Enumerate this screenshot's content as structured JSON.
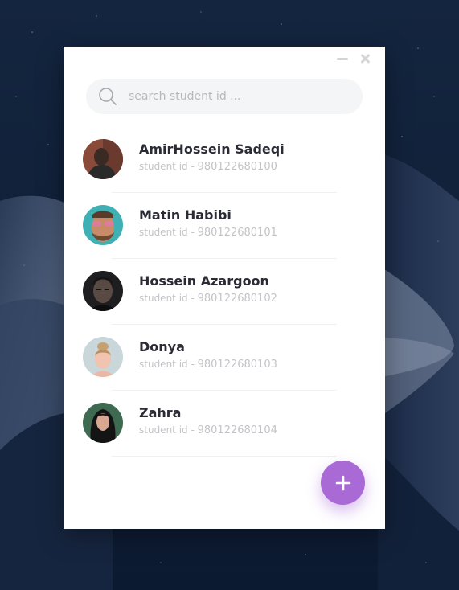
{
  "window": {
    "minimize_label": "",
    "close_label": ""
  },
  "search": {
    "placeholder": "search student id ..."
  },
  "students": [
    {
      "name": "AmirHossein Sadeqi",
      "id_label": "student id - ",
      "id": "980122680100"
    },
    {
      "name": "Matin Habibi",
      "id_label": "student id - ",
      "id": "980122680101"
    },
    {
      "name": "Hossein Azargoon",
      "id_label": "student id - ",
      "id": "980122680102"
    },
    {
      "name": "Donya",
      "id_label": "student id - ",
      "id": "980122680103"
    },
    {
      "name": "Zahra",
      "id_label": "student id - ",
      "id": "980122680104"
    }
  ],
  "fab": {
    "icon": "plus-icon",
    "color": "#a96ad6"
  },
  "colors": {
    "accent": "#a96ad6",
    "name_text": "#2b2b35",
    "secondary_text": "#c4c4c8",
    "search_bg": "#f4f5f7"
  }
}
